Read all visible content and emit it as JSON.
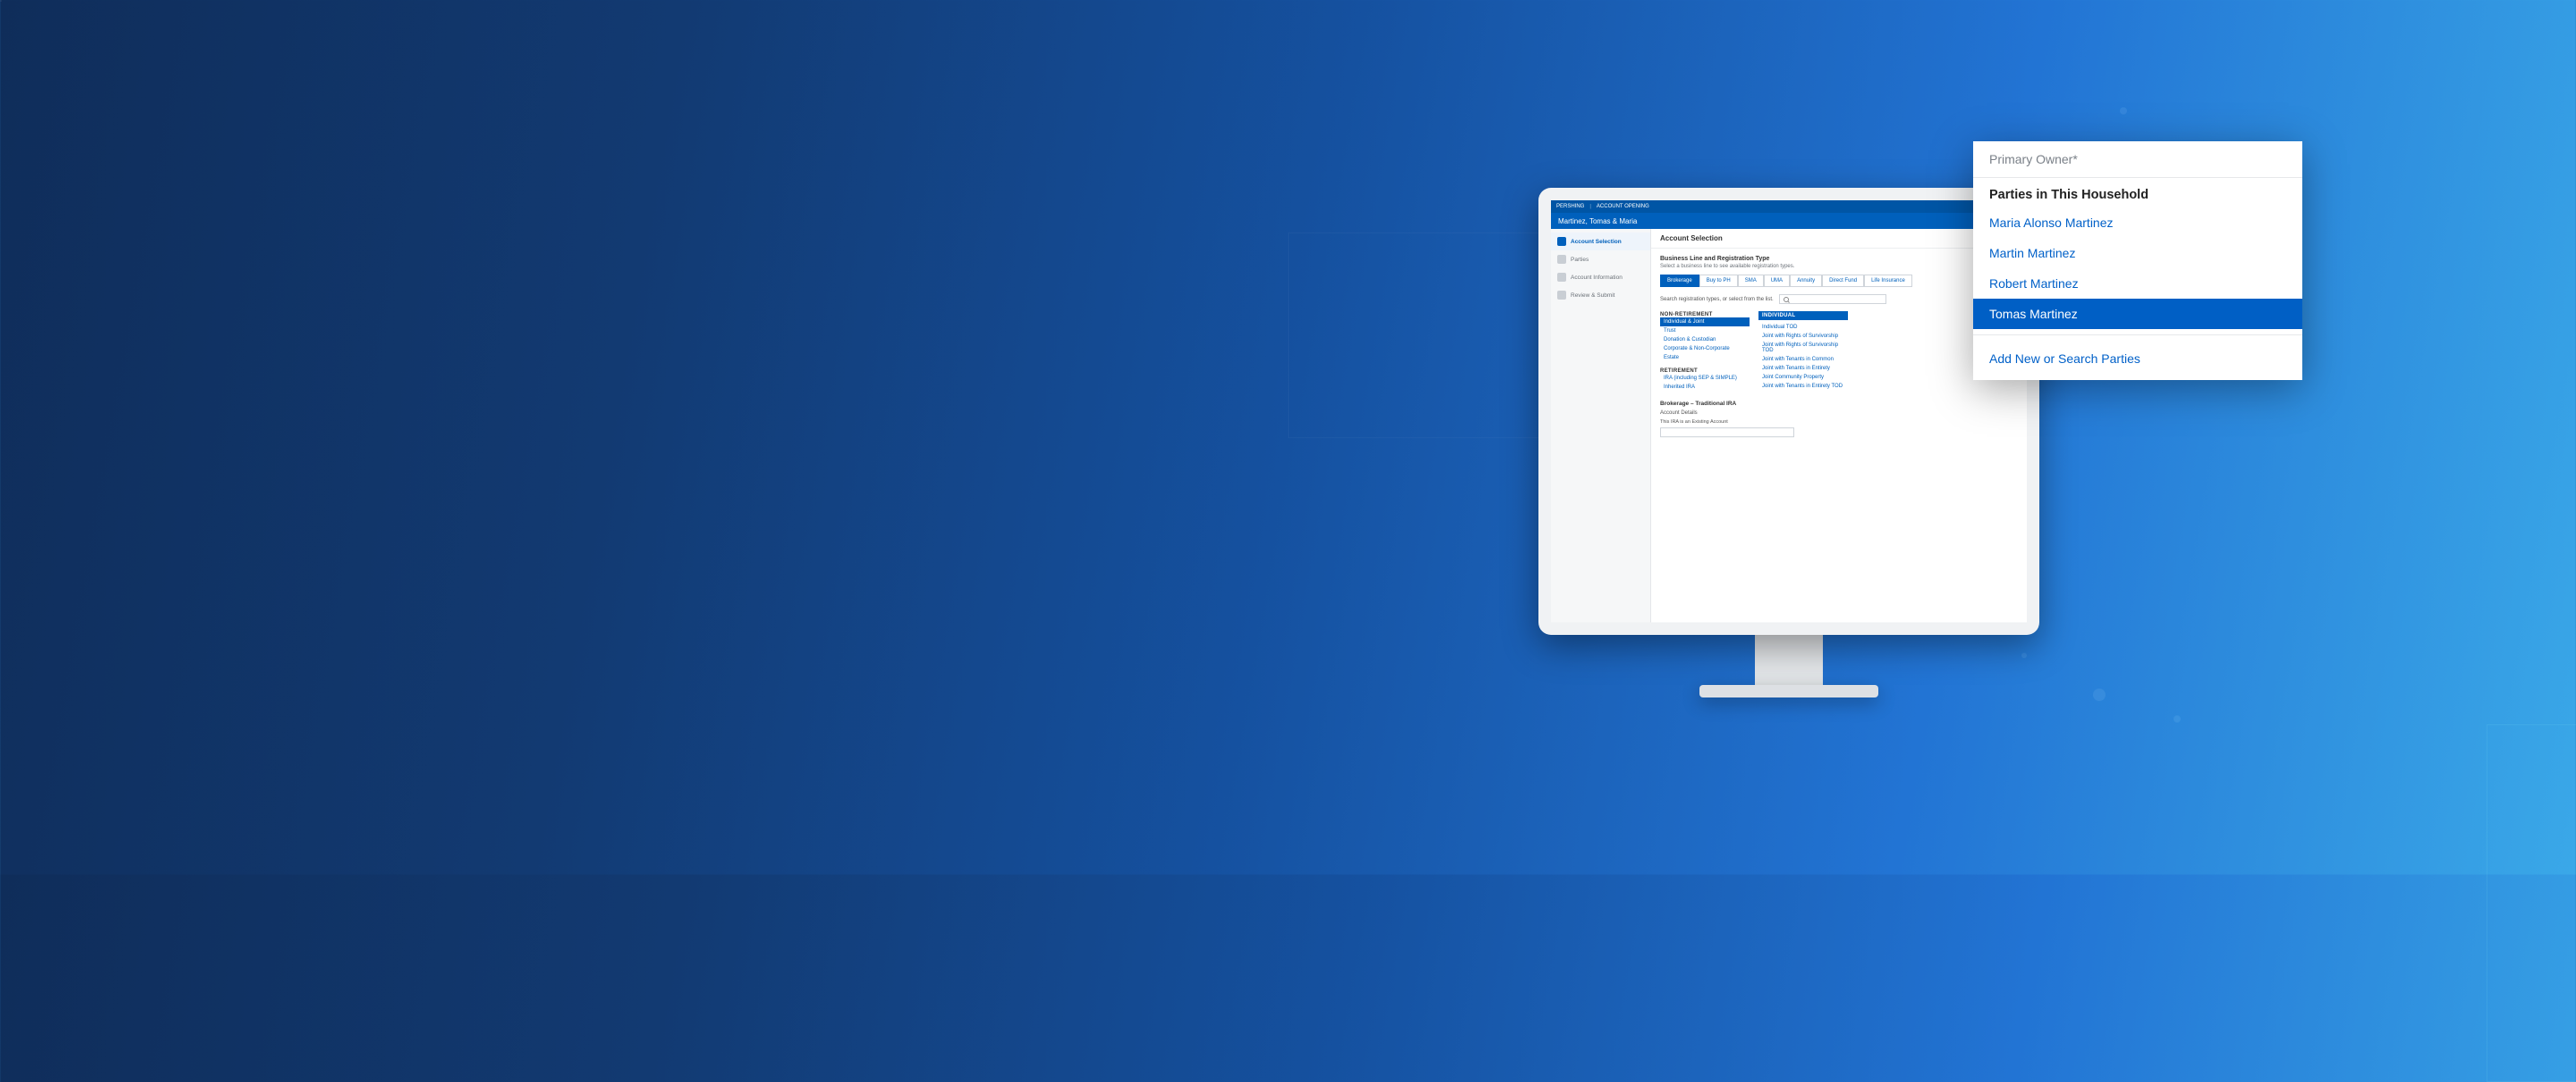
{
  "app": {
    "brand_left": "PERSHING",
    "brand_right": "ACCOUNT OPENING",
    "household": "Martinez, Tomas & Maria"
  },
  "sidebar": {
    "items": [
      {
        "label": "Account Selection",
        "active": true
      },
      {
        "label": "Parties",
        "active": false
      },
      {
        "label": "Account Information",
        "active": false
      },
      {
        "label": "Review & Submit",
        "active": false
      }
    ]
  },
  "main": {
    "title": "Account Selection",
    "section_label": "Business Line and Registration Type",
    "section_sub": "Select a business line to see available registration types.",
    "search_label": "Search registration types, or select from the list.",
    "summary_line": "Brokerage – Traditional IRA",
    "details_label": "Account Details",
    "details_sub": "This IRA is an Existing Account"
  },
  "business_lines": [
    {
      "label": "Brokerage",
      "active": true
    },
    {
      "label": "Buy to PH",
      "active": false
    },
    {
      "label": "SMA",
      "active": false
    },
    {
      "label": "UMA",
      "active": false
    },
    {
      "label": "Annuity",
      "active": false
    },
    {
      "label": "Direct Fund",
      "active": false
    },
    {
      "label": "Life Insurance",
      "active": false
    }
  ],
  "registration": {
    "left": {
      "group1_label": "NON-RETIREMENT",
      "group1_items": [
        {
          "label": "Individual & Joint",
          "selected": true
        },
        {
          "label": "Trust",
          "selected": false
        },
        {
          "label": "Donation & Custodian",
          "selected": false
        },
        {
          "label": "Corporate & Non-Corporate",
          "selected": false
        },
        {
          "label": "Estate",
          "selected": false
        }
      ],
      "group2_label": "RETIREMENT",
      "group2_items": [
        {
          "label": "IRA (including SEP & SIMPLE)",
          "selected": false
        },
        {
          "label": "Inherited IRA",
          "selected": false
        }
      ]
    },
    "right": {
      "header": "Individual",
      "items": [
        "Individual TOD",
        "Joint with Rights of Survivorship",
        "Joint with Rights of Survivorship TOD",
        "Joint with Tenants in Common",
        "Joint with Tenants in Entirety",
        "Joint Community Property",
        "Joint with Tenants in Entirety TOD"
      ]
    }
  },
  "popout": {
    "field_label": "Primary Owner*",
    "section_label": "Parties in This Household",
    "items": [
      {
        "label": "Maria Alonso Martinez",
        "selected": false
      },
      {
        "label": "Martin Martinez",
        "selected": false
      },
      {
        "label": "Robert Martinez",
        "selected": false
      },
      {
        "label": "Tomas Martinez",
        "selected": true
      }
    ],
    "add_label": "Add New or Search Parties"
  }
}
